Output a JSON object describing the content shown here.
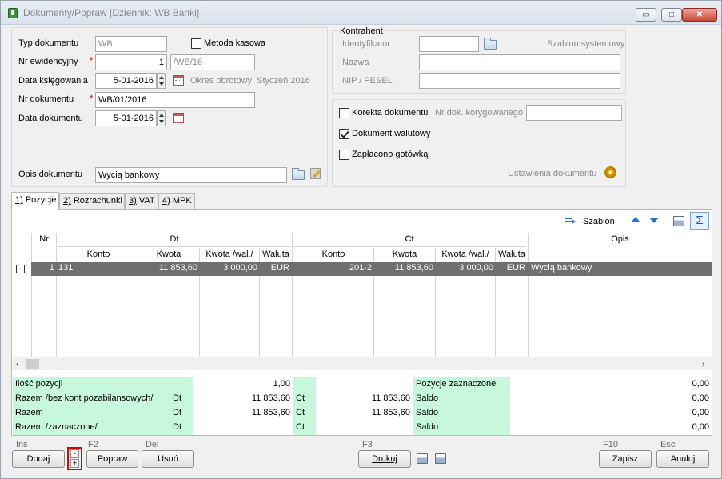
{
  "window": {
    "title": "Dokumenty/Popraw [Dziennik: WB  Banki]",
    "minimize": "▭",
    "maximize": "□",
    "close": "✕"
  },
  "form": {
    "typ_label": "Typ dokumentu",
    "typ_value": "WB",
    "metoda_label": "Metoda kasowa",
    "nr_ewid_label": "Nr ewidencyjny",
    "nr_ewid_value": "1",
    "nr_ewid_suffix": "/WB/16",
    "data_ksieg_label": "Data księgowania",
    "data_ksieg_value": "5-01-2016",
    "okres_text": "Okres obrotowy: Styczeń 2016",
    "nr_dok_label": "Nr dokumentu",
    "nr_dok_value": "WB/01/2016",
    "data_dok_label": "Data dokumentu",
    "data_dok_value": "5-01-2016",
    "opis_label": "Opis dokumentu",
    "opis_value": "Wycią bankowy",
    "required_mark": "*"
  },
  "kontrahent": {
    "title": "Kontrahent",
    "identyfikator_label": "Identyfikator",
    "szablon_label": "Szablon systemowy",
    "nazwa_label": "Nazwa",
    "nip_label": "NIP / PESEL"
  },
  "options": {
    "korekta_label": "Korekta dokumentu",
    "nr_korygowanego_label": "Nr dok. korygowanego",
    "walutowy_label": "Dokument walutowy",
    "walutowy_checked": true,
    "gotowka_label": "Zapłacono gotówką",
    "ustawienia_label": "Ustawienia dokumentu"
  },
  "tabs": [
    {
      "key": "1)",
      "label": " Pozycje"
    },
    {
      "key": "2)",
      "label": " Rozrachunki"
    },
    {
      "key": "3)",
      "label": " VAT"
    },
    {
      "key": "4)",
      "label": " MPK"
    }
  ],
  "toolbar": {
    "szablon_label": "Szablon",
    "sigma": "Σ"
  },
  "grid": {
    "col_nr": "Nr",
    "group_dt": "Dt",
    "group_ct": "Ct",
    "col_opis": "Opis",
    "col_konto": "Konto",
    "col_kwota": "Kwota",
    "col_kwota_wal": "Kwota /wal./",
    "col_waluta": "Waluta",
    "rows": [
      {
        "nr": "1",
        "dt_konto": "131",
        "dt_kwota": "11 853,60",
        "dt_kwota_wal": "3 000,00",
        "dt_waluta": "EUR",
        "ct_konto": "201-2",
        "ct_kwota": "11 853,60",
        "ct_kwota_wal": "3 000,00",
        "ct_waluta": "EUR",
        "opis": "Wycią bankowy"
      }
    ]
  },
  "summary": {
    "rows": [
      {
        "label": "Ilość pozycji",
        "dt": "",
        "dt_val": "1,00",
        "ct": "",
        "ct_val": "",
        "right_label": "Pozycje zaznaczone",
        "right_val": "0,00"
      },
      {
        "label": "Razem /bez kont pozabilansowych/",
        "dt": "Dt",
        "dt_val": "11 853,60",
        "ct": "Ct",
        "ct_val": "11 853,60",
        "right_label": "Saldo",
        "right_val": "0,00"
      },
      {
        "label": "Razem",
        "dt": "Dt",
        "dt_val": "11 853,60",
        "ct": "Ct",
        "ct_val": "11 853,60",
        "right_label": "Saldo",
        "right_val": "0,00"
      },
      {
        "label": "Razem /zaznaczone/",
        "dt": "Dt",
        "dt_val": "",
        "ct": "Ct",
        "ct_val": "",
        "right_label": "Saldo",
        "right_val": "0,00"
      }
    ]
  },
  "buttons": {
    "ins_key": "Ins",
    "dodaj": "Dodaj",
    "minus": "-",
    "plus": "+",
    "f2_key": "F2",
    "popraw": "Popraw",
    "del_key": "Del",
    "usun": "Usuń",
    "f3_key": "F3",
    "drukuj": "Drukuj",
    "f10_key": "F10",
    "zapisz": "Zapisz",
    "esc_key": "Esc",
    "anuluj": "Anuluj"
  }
}
